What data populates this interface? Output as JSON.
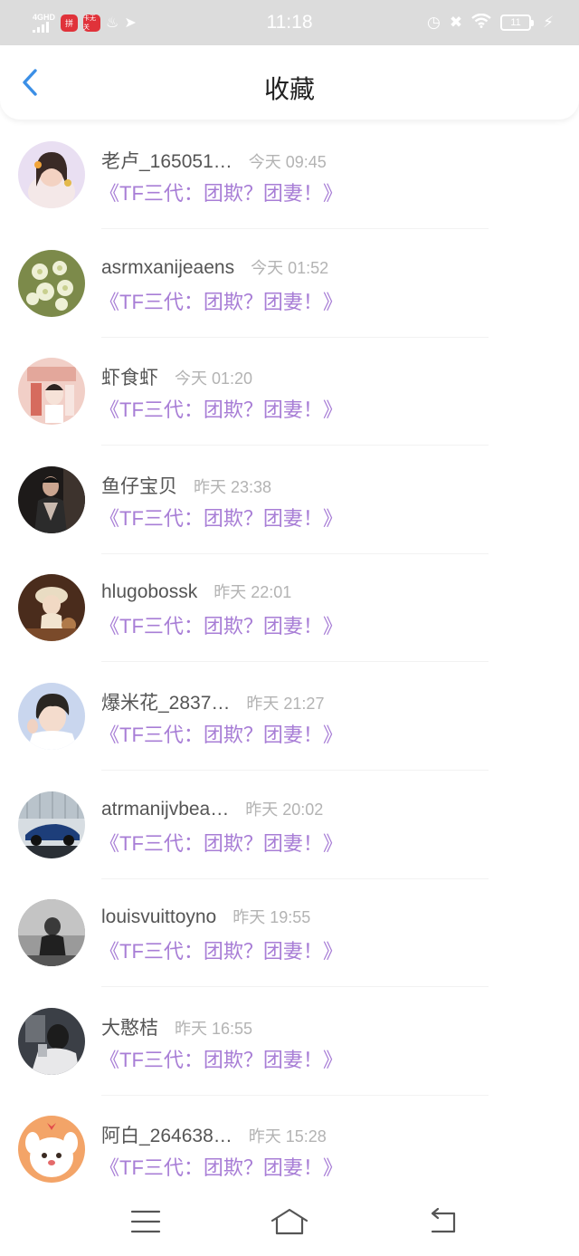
{
  "status_bar": {
    "network": "4GHD",
    "time": "11:18",
    "battery": "11",
    "app_icon_labels": [
      "拼",
      "卡无关"
    ]
  },
  "header": {
    "title": "收藏",
    "back_icon": "chevron-left-icon"
  },
  "colors": {
    "accent": "#3b8fe6",
    "link_purple": "#a87ed6",
    "time_gray": "#b3b3b3",
    "status_bar_bg": "#dcdcdc"
  },
  "items": [
    {
      "name": "老卢_165051…",
      "time": "今天 09:45",
      "collection": "《TF三代：团欺？团妻！》"
    },
    {
      "name": "asrmxanijeaens",
      "time": "今天 01:52",
      "collection": "《TF三代：团欺？团妻！》"
    },
    {
      "name": "虾食虾",
      "time": "今天 01:20",
      "collection": "《TF三代：团欺？团妻！》"
    },
    {
      "name": "鱼仔宝贝",
      "time": "昨天 23:38",
      "collection": "《TF三代：团欺？团妻！》"
    },
    {
      "name": "hlugobossk",
      "time": "昨天 22:01",
      "collection": "《TF三代：团欺？团妻！》"
    },
    {
      "name": "爆米花_2837…",
      "time": "昨天 21:27",
      "collection": "《TF三代：团欺？团妻！》"
    },
    {
      "name": "atrmanijvbea…",
      "time": "昨天 20:02",
      "collection": "《TF三代：团欺？团妻！》"
    },
    {
      "name": "louisvuittoyno",
      "time": "昨天 19:55",
      "collection": "《TF三代：团欺？团妻！》"
    },
    {
      "name": "大憨桔",
      "time": "昨天 16:55",
      "collection": "《TF三代：团欺？团妻！》"
    },
    {
      "name": "阿白_264638…",
      "time": "昨天 15:28",
      "collection": "《TF三代：团欺？团妻！》"
    }
  ],
  "nav": {
    "menu_icon": "menu-icon",
    "home_icon": "home-icon",
    "back_icon": "return-icon"
  }
}
